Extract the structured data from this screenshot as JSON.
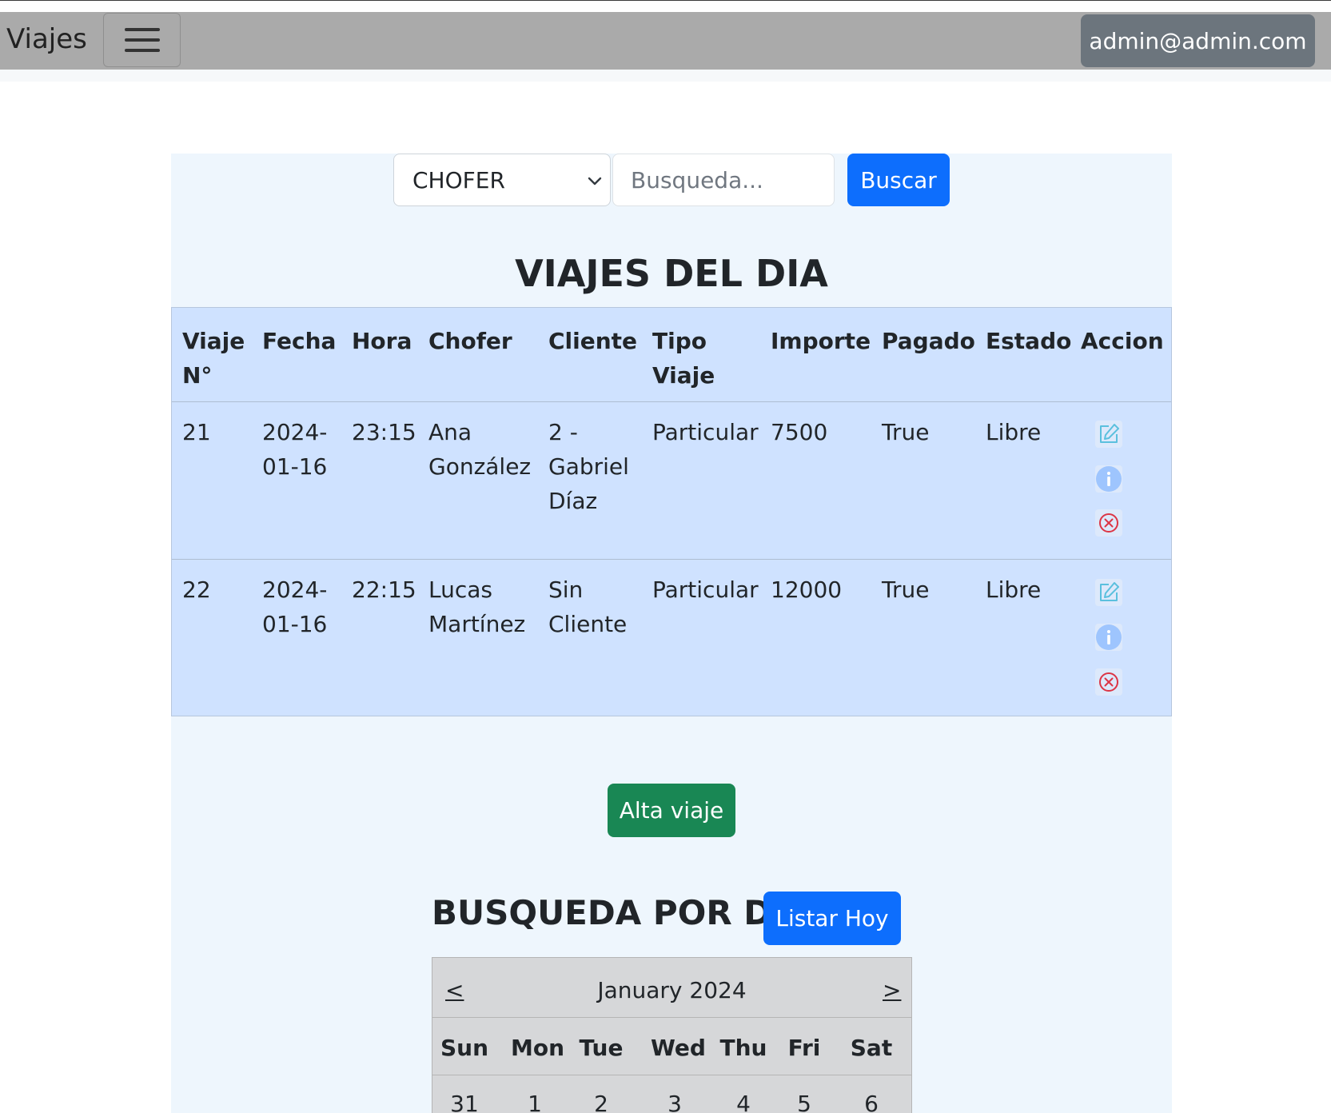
{
  "navbar": {
    "brand": "Viajes",
    "user_email": "admin@admin.com"
  },
  "search": {
    "filter_selected": "CHOFER",
    "placeholder": "Busqueda...",
    "value": "",
    "button_label": "Buscar"
  },
  "trips": {
    "title": "VIAJES DEL DIA",
    "headers": {
      "viaje_1": "Viaje",
      "viaje_2": "N°",
      "fecha": "Fecha",
      "hora": "Hora",
      "chofer": "Chofer",
      "cliente": "Cliente",
      "tipo_1": "Tipo",
      "tipo_2": "Viaje",
      "importe": "Importe",
      "pagado": "Pagado",
      "estado": "Estado",
      "accion": "Accion"
    },
    "rows": [
      {
        "numero": "21",
        "fecha_1": "2024-",
        "fecha_2": "01-16",
        "hora": "23:15",
        "chofer_1": "Ana",
        "chofer_2": "González",
        "cliente_1": "2 -",
        "cliente_2": "Gabriel",
        "cliente_3": "Díaz",
        "tipo": "Particular",
        "importe": "7500",
        "pagado": "True",
        "estado": "Libre"
      },
      {
        "numero": "22",
        "fecha_1": "2024-",
        "fecha_2": "01-16",
        "hora": "22:15",
        "chofer_1": "Lucas",
        "chofer_2": "Martínez",
        "cliente_1": "Sin",
        "cliente_2": "Cliente",
        "cliente_3": "",
        "tipo": "Particular",
        "importe": "12000",
        "pagado": "True",
        "estado": "Libre"
      }
    ],
    "action_icons": [
      "edit-icon",
      "info-icon",
      "delete-icon"
    ]
  },
  "add_trip_label": "Alta viaje",
  "day_search": {
    "title": "BUSQUEDA POR DIA",
    "today_button": "Listar Hoy",
    "calendar": {
      "prev": "<",
      "next": ">",
      "month_label": "January 2024",
      "day_names": [
        "Sun",
        "Mon",
        "Tue",
        "Wed",
        "Thu",
        "Fri",
        "Sat"
      ],
      "first_week": [
        "31",
        "1",
        "2",
        "3",
        "4",
        "5",
        "6"
      ]
    }
  },
  "colors": {
    "navbar": "#aaaaaa",
    "primary": "#0d6efd",
    "success": "#198754",
    "secondary": "#6c757d",
    "table_bg": "#cfe2ff",
    "panel_bg": "#eef6fd",
    "edit_icon": "#5bc0de",
    "info_icon": "#9ec5fe",
    "delete_icon": "#dc3545"
  }
}
